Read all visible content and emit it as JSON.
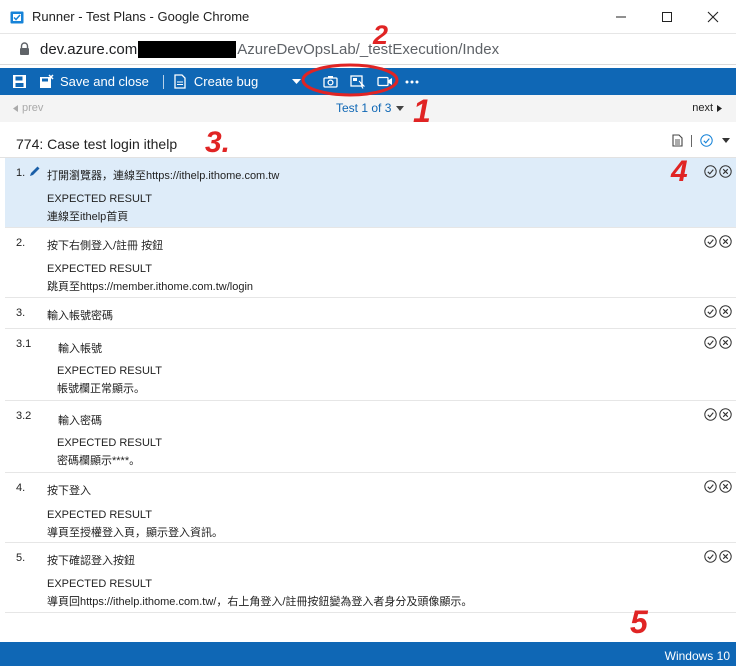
{
  "window": {
    "title": "Runner - Test Plans - Google Chrome"
  },
  "address": {
    "url_prefix": "dev.azure.com",
    "url_suffix": "AzureDevOpsLab/_testExecution/Index"
  },
  "toolbar": {
    "save_close_label": "Save and close",
    "create_bug_label": "Create bug"
  },
  "nav": {
    "prev_label": "prev",
    "counter": "Test 1 of 3",
    "next_label": "next"
  },
  "case": {
    "title": "774: Case test login ithelp"
  },
  "steps": [
    {
      "num": "1.",
      "action": "打開瀏覽器，連線至https://ithelp.ithome.com.tw",
      "expected_label": "EXPECTED RESULT",
      "expected": "連線至ithelp首頁"
    },
    {
      "num": "2.",
      "action": "按下右側登入/註冊 按鈕",
      "expected_label": "EXPECTED RESULT",
      "expected": "跳頁至https://member.ithome.com.tw/login"
    },
    {
      "num": "3.",
      "action": "輸入帳號密碼"
    },
    {
      "num": "3.1",
      "action": "輸入帳號",
      "expected_label": "EXPECTED RESULT",
      "expected": "帳號欄正常顯示。"
    },
    {
      "num": "3.2",
      "action": "輸入密碼",
      "expected_label": "EXPECTED RESULT",
      "expected": "密碼欄顯示****。"
    },
    {
      "num": "4.",
      "action": "按下登入",
      "expected_label": "EXPECTED RESULT",
      "expected": "導頁至授權登入頁，顯示登入資訊。"
    },
    {
      "num": "5.",
      "action": "按下確認登入按鈕",
      "expected_label": "EXPECTED RESULT",
      "expected": "導頁回https://ithelp.ithome.com.tw/，右上角登入/註冊按鈕變為登入者身分及頭像顯示。"
    }
  ],
  "status": {
    "text": "Windows 10"
  },
  "annotations": {
    "a1": "1",
    "a2": "2",
    "a3": "3.",
    "a4": "4",
    "a5": "5"
  },
  "colors": {
    "accent": "#0f67b5",
    "selected_row": "#deecf9",
    "annotation": "#e02424"
  }
}
